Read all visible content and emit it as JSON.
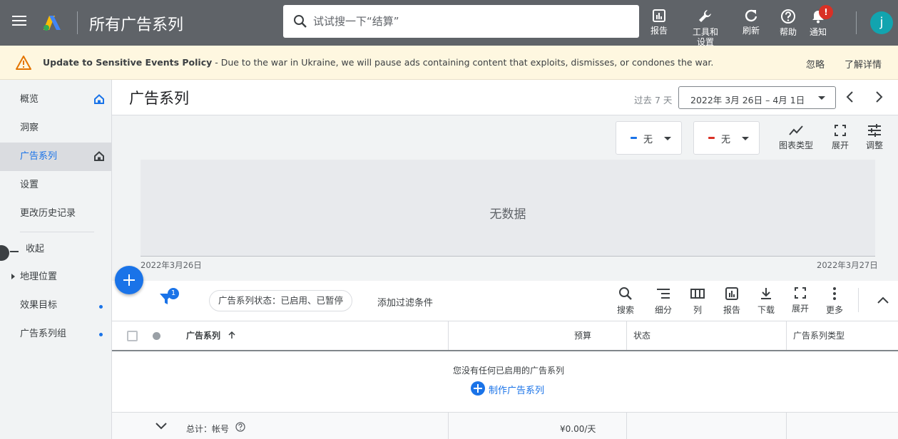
{
  "header": {
    "app_title": "所有广告系列",
    "search_placeholder": "试试搜一下“结算”",
    "actions": {
      "reports": "报告",
      "tools": "工具和设置",
      "refresh": "刷新",
      "help": "帮助",
      "notifications": "通知"
    },
    "notification_badge": "!",
    "avatar_initial": "j"
  },
  "banner": {
    "title": "Update to Sensitive Events Policy",
    "message": " - Due to the war in Ukraine, we will pause ads containing content that exploits, dismisses, or condones the war.",
    "dismiss": "忽略",
    "learn_more": "了解详情"
  },
  "sidebar": {
    "items": [
      "概览",
      "洞察",
      "广告系列",
      "设置",
      "更改历史记录"
    ],
    "collapse_label": "收起",
    "groups": [
      "地理位置",
      "效果目标",
      "广告系列组"
    ]
  },
  "page": {
    "title": "广告系列",
    "date_prefix": "过去 7 天",
    "date_range": "2022年 3月 26日 – 4月 1日"
  },
  "chart": {
    "metric_1": "无",
    "metric_2": "无",
    "chart_type_label": "图表类型",
    "expand_label": "展开",
    "adjust_label": "调整",
    "no_data": "无数据",
    "x_start": "2022年3月26日",
    "x_end": "2022年3月27日",
    "colors": {
      "metric_1": "#1a73e8",
      "metric_2": "#d93025"
    }
  },
  "toolbar": {
    "filter_count": "1",
    "filter_chip": "广告系列状态：已启用、已暂停",
    "add_filter": "添加过滤条件",
    "tools": {
      "search": "搜索",
      "segment": "细分",
      "columns": "列",
      "reports": "报告",
      "download": "下载",
      "expand": "展开",
      "more": "更多"
    }
  },
  "table": {
    "columns": {
      "campaign": "广告系列",
      "budget": "预算",
      "status": "状态",
      "type": "广告系列类型"
    },
    "empty_message": "您没有任何已启用的广告系列",
    "create_link": "制作广告系列",
    "total_label": "总计：帐号",
    "total_budget": "¥0.00/天"
  },
  "colors": {
    "topbar": "#5f6368",
    "accent": "#1a73e8",
    "alert": "#d93025",
    "banner": "#fef7e0"
  }
}
